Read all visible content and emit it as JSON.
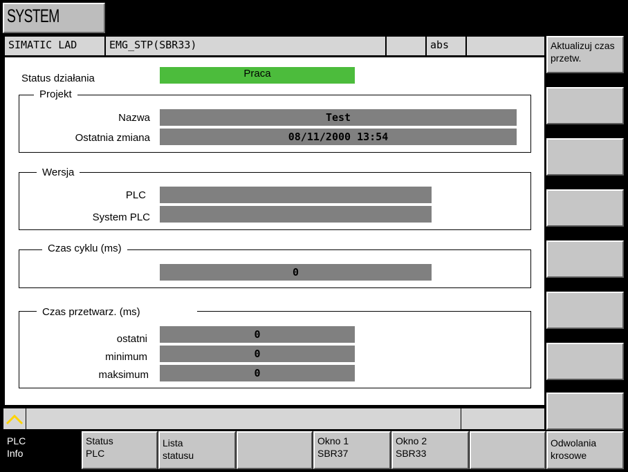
{
  "system_area": {
    "label": "SYSTEM"
  },
  "header": {
    "program_type": "SIMATIC LAD",
    "block_name": "EMG_STP(SBR33)",
    "cell_3": "",
    "mode": "abs",
    "cell_5": ""
  },
  "status": {
    "label": "Status działania",
    "value": "Praca",
    "color": "#4cbc3c"
  },
  "project": {
    "title": "Projekt",
    "name_label": "Nazwa",
    "name_value": "Test",
    "last_change_label": "Ostatnia zmiana",
    "last_change_value": "08/11/2000 13:54"
  },
  "version": {
    "title": "Wersja",
    "plc_label": "PLC",
    "plc_value": "",
    "system_plc_label": "System PLC",
    "system_plc_value": ""
  },
  "cycle_time": {
    "title": "Czas cyklu (ms)",
    "value": "0"
  },
  "processing_time": {
    "title": "Czas przetwarz.  (ms)",
    "last_label": "ostatni",
    "last_value": "0",
    "min_label": "minimum",
    "min_value": "0",
    "max_label": "maksimum",
    "max_value": "0"
  },
  "vertical_softkeys": [
    {
      "label": "Aktualizuj czas przetw."
    },
    {
      "label": ""
    },
    {
      "label": ""
    },
    {
      "label": ""
    },
    {
      "label": ""
    },
    {
      "label": ""
    },
    {
      "label": ""
    },
    {
      "label": ""
    }
  ],
  "horizontal_softkeys": [
    {
      "label_line1": "PLC",
      "label_line2": "Info",
      "active": true
    },
    {
      "label_line1": "Status",
      "label_line2": "PLC"
    },
    {
      "label_line1": "Lista",
      "label_line2": "statusu"
    },
    {
      "label_line1": "",
      "label_line2": ""
    },
    {
      "label_line1": "Okno 1",
      "label_line2": "SBR37"
    },
    {
      "label_line1": "Okno 2",
      "label_line2": "SBR33"
    },
    {
      "label_line1": "",
      "label_line2": ""
    },
    {
      "label_line1": "Odwolania",
      "label_line2": "krosowe"
    }
  ],
  "colors": {
    "panel_bg": "#ffffff",
    "field_bg": "#808080",
    "softkey_bg": "#c6c6c6",
    "active_softkey_bg": "#000000",
    "recall_arrow": "#ffd400"
  },
  "icons": {
    "recall": "recall-chevron-up-icon"
  }
}
